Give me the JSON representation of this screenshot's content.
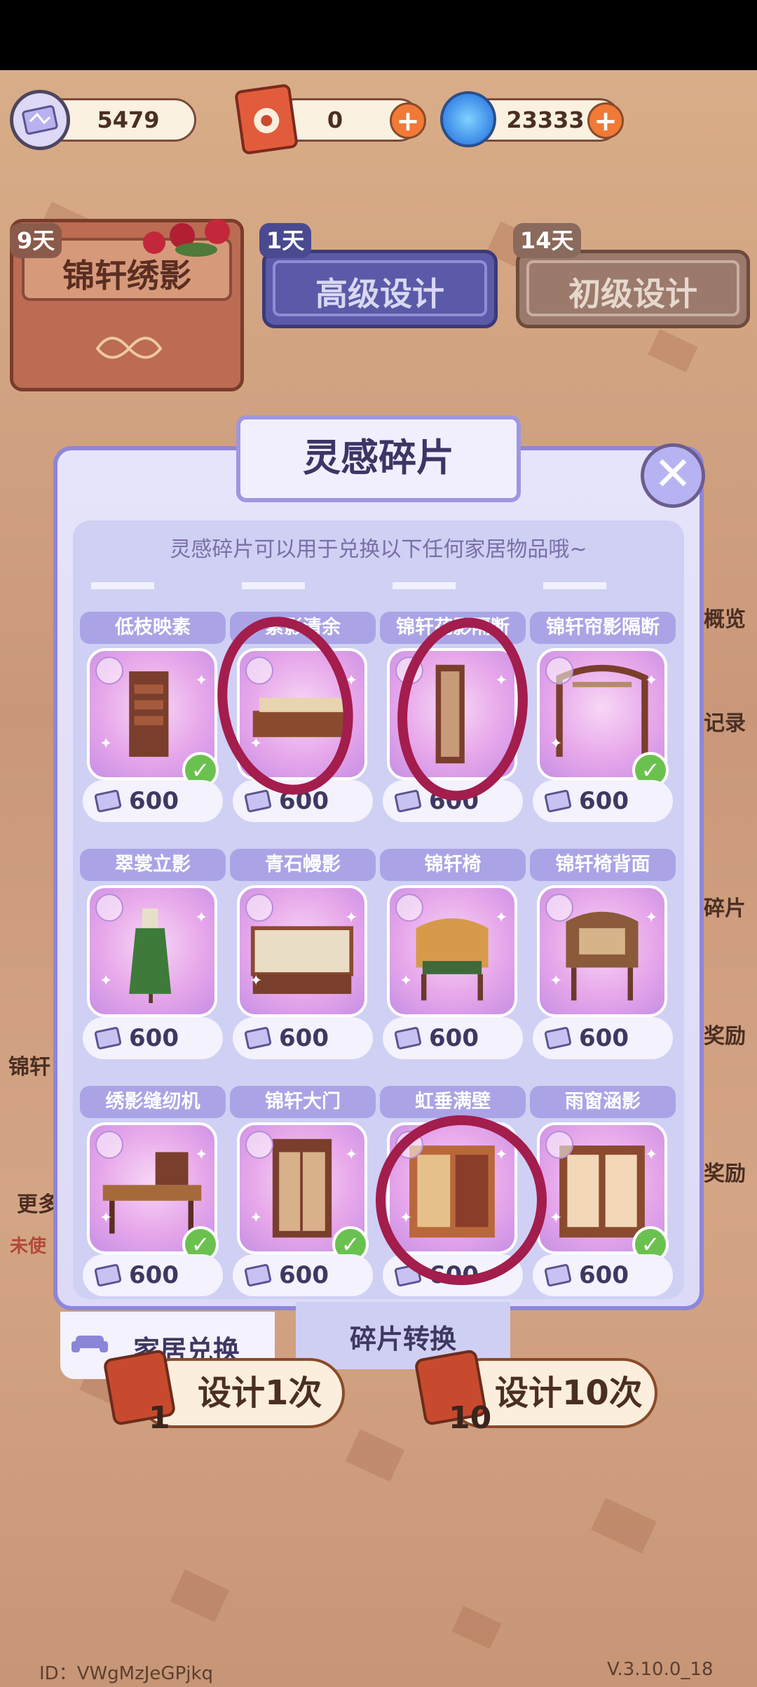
{
  "currency": {
    "fragments": "5479",
    "tickets": "0",
    "gems": "23333"
  },
  "top_tabs": [
    {
      "label": "锦轩绣影",
      "days": "9天"
    },
    {
      "label": "高级设计",
      "days": "1天"
    },
    {
      "label": "初级设计",
      "days": "14天"
    }
  ],
  "side": {
    "overview": "概览",
    "records": "记录",
    "fragments": "碎片",
    "reward_1": "奖励",
    "reward_2": "奖励",
    "left_label": "锦轩",
    "more": "更多",
    "unused": "未使"
  },
  "modal": {
    "title": "灵感碎片",
    "subtitle": "灵感碎片可以用于兑换以下任何家居物品哦~",
    "items": [
      {
        "name": "低枝映素",
        "price": "600",
        "owned": true
      },
      {
        "name": "素影清余",
        "price": "600",
        "owned": false
      },
      {
        "name": "锦轩花影隔断",
        "price": "600",
        "owned": false
      },
      {
        "name": "锦轩帘影隔断",
        "price": "600",
        "owned": true
      },
      {
        "name": "翠裳立影",
        "price": "600",
        "owned": false
      },
      {
        "name": "青石幔影",
        "price": "600",
        "owned": false
      },
      {
        "name": "锦轩椅",
        "price": "600",
        "owned": false
      },
      {
        "name": "锦轩椅背面",
        "price": "600",
        "owned": false
      },
      {
        "name": "绣影缝纫机",
        "price": "600",
        "owned": true
      },
      {
        "name": "锦轩大门",
        "price": "600",
        "owned": true
      },
      {
        "name": "虹垂满壁",
        "price": "600",
        "owned": false
      },
      {
        "name": "雨窗涵影",
        "price": "600",
        "owned": true
      }
    ]
  },
  "bottom_tabs": {
    "furniture_exchange": "家居兑换",
    "fragment_convert": "碎片转换"
  },
  "draw": {
    "once": "设计1次",
    "once_cost": "1",
    "ten": "设计10次",
    "ten_cost": "10"
  },
  "footer": {
    "id": "ID：VWgMzJeGPjkq",
    "version": "V.3.10.0_18"
  },
  "colors": {
    "accent_purple": "#8f86d8",
    "brown": "#7a4a3a",
    "check_green": "#6bc14f",
    "annotation": "#a31d4d"
  }
}
